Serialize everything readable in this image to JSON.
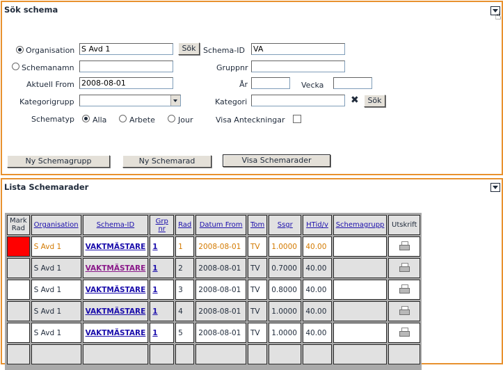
{
  "search": {
    "title": "Sök schema",
    "organisation_label": "Organisation",
    "organisation_value": "S Avd 1",
    "org_search_button": "Sök",
    "schema_id_label": "Schema-ID",
    "schema_id_value": "VA",
    "schemanamn_label": "Schemanamn",
    "schemanamn_value": "",
    "gruppnr_label": "Gruppnr",
    "gruppnr_value": "",
    "aktuell_from_label": "Aktuell From",
    "aktuell_from_value": "2008-08-01",
    "ar_label": "År",
    "ar_value": "",
    "vecka_label": "Vecka",
    "vecka_value": "",
    "kategorigrupp_label": "Kategorigrupp",
    "kategorigrupp_value": "",
    "kategori_label": "Kategori",
    "kategori_value": "",
    "kategori_search_button": "Sök",
    "schematyp_label": "Schematyp",
    "schematyp_options": [
      "Alla",
      "Arbete",
      "Jour"
    ],
    "visa_anteckningar_label": "Visa Anteckningar",
    "buttons": {
      "ny_schemagrupp": "Ny Schemagrupp",
      "ny_schemarad": "Ny Schemarad",
      "visa_schemarader": "Visa Schemarader"
    }
  },
  "list": {
    "title": "Lista Schemarader",
    "headers": [
      "Mark Rad",
      "Organisation",
      "Schema-ID",
      "Grp nr",
      "Rad",
      "Datum From",
      "Tom",
      "Ssgr",
      "HTid/v",
      "Schemagrupp",
      "Utskrift"
    ],
    "rows": [
      {
        "org": "S Avd 1",
        "schema_id": "VAKTMÄSTARE",
        "grp": "1",
        "rad": "1",
        "datum": "2008-08-01",
        "tom": "TV",
        "ssgr": "1.0000",
        "htid": "40.00",
        "schemagrupp": ""
      },
      {
        "org": "S Avd 1",
        "schema_id": "VAKTMÄSTARE",
        "grp": "1",
        "rad": "2",
        "datum": "2008-08-01",
        "tom": "TV",
        "ssgr": "0.7000",
        "htid": "40.00",
        "schemagrupp": ""
      },
      {
        "org": "S Avd 1",
        "schema_id": "VAKTMÄSTARE",
        "grp": "1",
        "rad": "3",
        "datum": "2008-08-01",
        "tom": "TV",
        "ssgr": "0.8000",
        "htid": "40.00",
        "schemagrupp": ""
      },
      {
        "org": "S Avd 1",
        "schema_id": "VAKTMÄSTARE",
        "grp": "1",
        "rad": "4",
        "datum": "2008-08-01",
        "tom": "TV",
        "ssgr": "1.0000",
        "htid": "40.00",
        "schemagrupp": ""
      },
      {
        "org": "S Avd 1",
        "schema_id": "VAKTMÄSTARE",
        "grp": "1",
        "rad": "5",
        "datum": "2008-08-01",
        "tom": "TV",
        "ssgr": "1.0000",
        "htid": "40.00",
        "schemagrupp": ""
      }
    ]
  },
  "colors": {
    "panel_border": "#e8912e",
    "selected_mark": "#ff0000",
    "first_row_text": "#d37a00",
    "link": "#1a0dab"
  }
}
